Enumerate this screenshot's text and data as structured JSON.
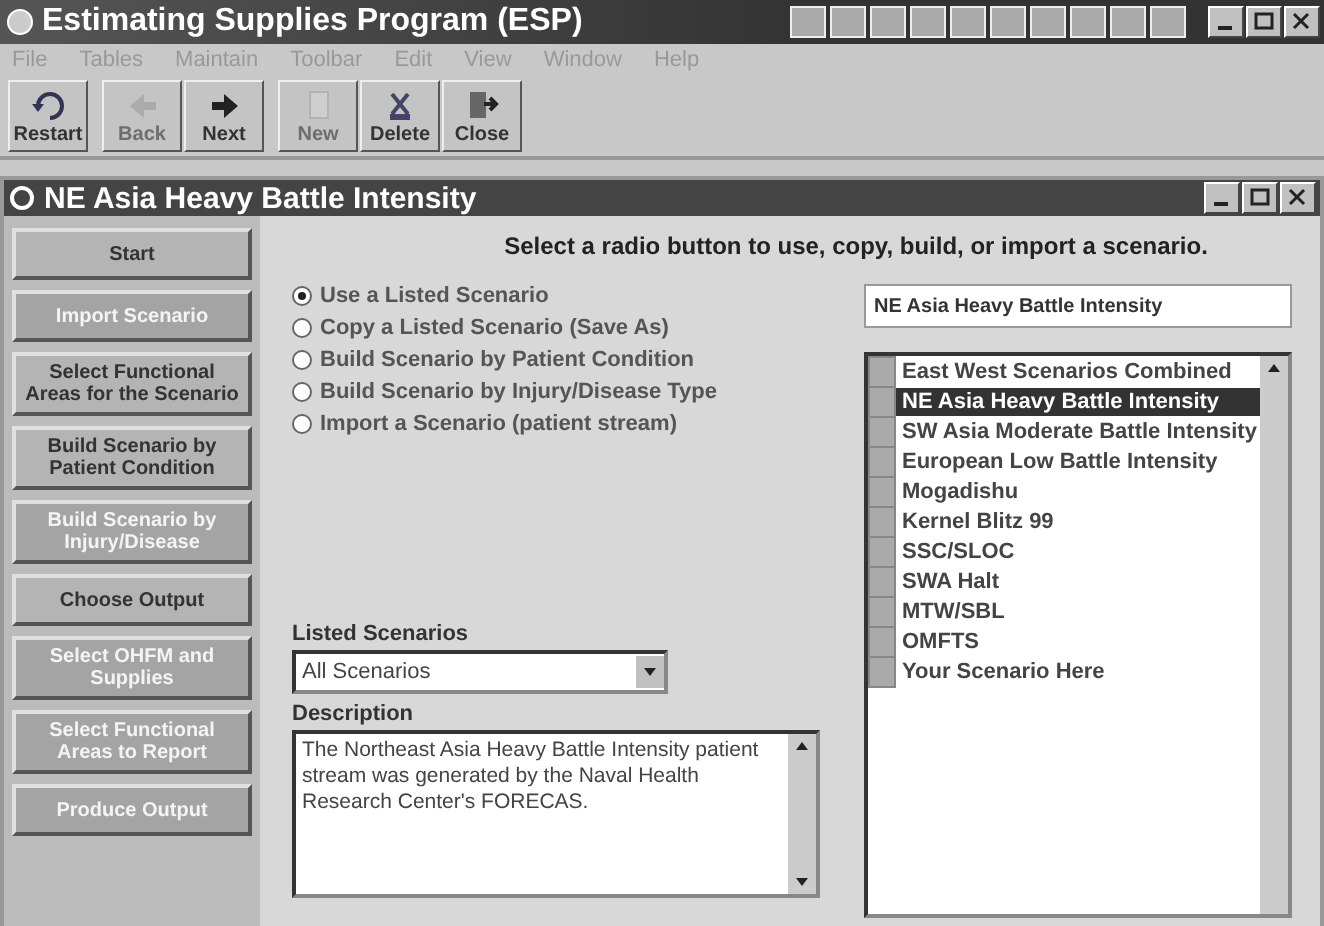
{
  "window": {
    "title": "Estimating Supplies Program (ESP)"
  },
  "menu": [
    "File",
    "Tables",
    "Maintain",
    "Toolbar",
    "Edit",
    "View",
    "Window",
    "Help"
  ],
  "toolbar": [
    {
      "label": "Restart",
      "kind": "restart",
      "disabled": false
    },
    {
      "label": "Back",
      "kind": "back",
      "disabled": true
    },
    {
      "label": "Next",
      "kind": "next",
      "disabled": false
    },
    {
      "label": "New",
      "kind": "new",
      "disabled": true
    },
    {
      "label": "Delete",
      "kind": "delete",
      "disabled": false
    },
    {
      "label": "Close",
      "kind": "close",
      "disabled": false
    }
  ],
  "child_window": {
    "title": "NE Asia Heavy Battle Intensity"
  },
  "sidebar": [
    {
      "label": "Start",
      "disabled": false
    },
    {
      "label": "Import Scenario",
      "disabled": true
    },
    {
      "label": "Select Functional Areas for the Scenario",
      "disabled": false
    },
    {
      "label": "Build Scenario by Patient Condition",
      "disabled": false
    },
    {
      "label": "Build Scenario by Injury/Disease",
      "disabled": true
    },
    {
      "label": "Choose Output",
      "disabled": false
    },
    {
      "label": "Select OHFM and Supplies",
      "disabled": true
    },
    {
      "label": "Select Functional Areas to Report",
      "disabled": true
    },
    {
      "label": "Produce Output",
      "disabled": true
    }
  ],
  "instruction": "Select a radio button to use, copy, build, or import a scenario.",
  "options": [
    {
      "label": "Use a Listed Scenario",
      "selected": true
    },
    {
      "label": "Copy a Listed Scenario (Save As)",
      "selected": false
    },
    {
      "label": "Build Scenario by Patient Condition",
      "selected": false
    },
    {
      "label": "Build Scenario by Injury/Disease Type",
      "selected": false
    },
    {
      "label": "Import a Scenario (patient stream)",
      "selected": false
    }
  ],
  "scenario_name": {
    "value": "NE Asia Heavy Battle Intensity"
  },
  "scenarios": [
    {
      "label": "East West Scenarios Combined",
      "selected": false
    },
    {
      "label": "NE Asia Heavy Battle Intensity",
      "selected": true
    },
    {
      "label": "SW Asia Moderate Battle Intensity",
      "selected": false
    },
    {
      "label": "European Low Battle Intensity",
      "selected": false
    },
    {
      "label": "Mogadishu",
      "selected": false
    },
    {
      "label": "Kernel Blitz 99",
      "selected": false
    },
    {
      "label": "SSC/SLOC",
      "selected": false
    },
    {
      "label": "SWA Halt",
      "selected": false
    },
    {
      "label": "MTW/SBL",
      "selected": false
    },
    {
      "label": "OMFTS",
      "selected": false
    },
    {
      "label": "Your Scenario Here",
      "selected": false
    }
  ],
  "listed_scenarios": {
    "label": "Listed Scenarios",
    "value": "All Scenarios"
  },
  "description": {
    "label": "Description",
    "value": "The Northeast Asia Heavy Battle Intensity patient stream was generated by the Naval Health Research Center's FORECAS."
  }
}
